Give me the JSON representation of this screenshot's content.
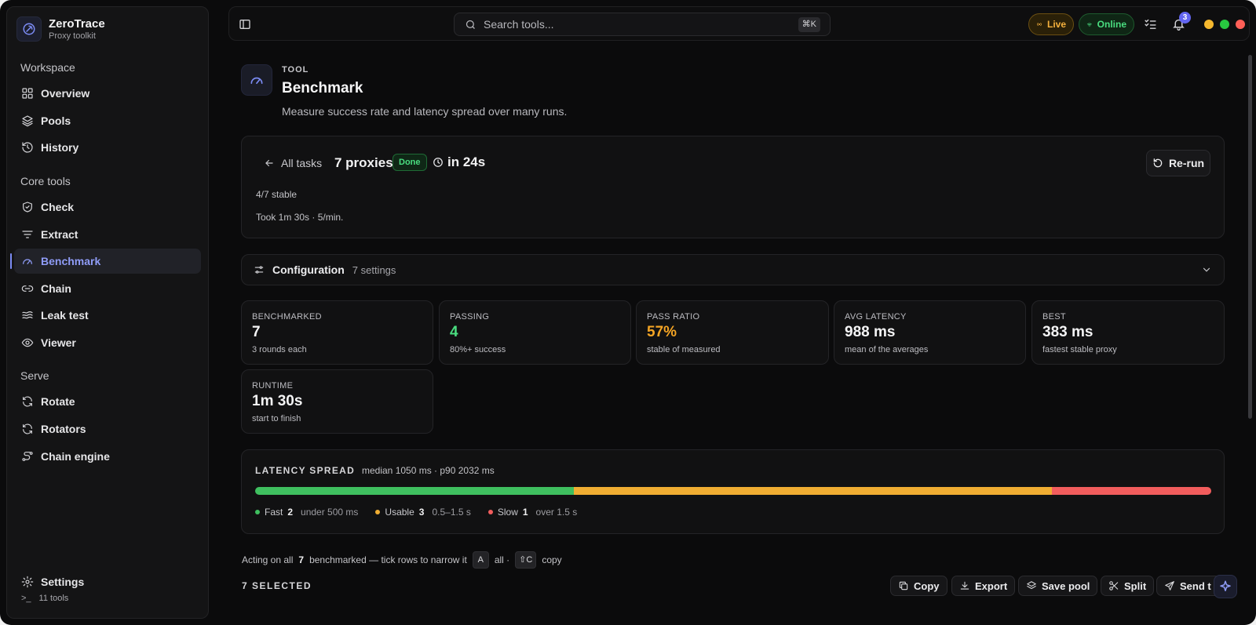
{
  "brand": {
    "name": "ZeroTrace",
    "subtitle": "Proxy toolkit"
  },
  "sidebar": {
    "sections": [
      {
        "title": "Workspace",
        "items": [
          {
            "label": "Overview",
            "icon": "grid-icon"
          },
          {
            "label": "Pools",
            "icon": "layers-icon"
          },
          {
            "label": "History",
            "icon": "history-icon"
          }
        ]
      },
      {
        "title": "Core tools",
        "items": [
          {
            "label": "Check",
            "icon": "shield-check-icon"
          },
          {
            "label": "Extract",
            "icon": "filter-icon"
          },
          {
            "label": "Benchmark",
            "icon": "gauge-icon",
            "active": true
          },
          {
            "label": "Chain",
            "icon": "link-icon"
          },
          {
            "label": "Leak test",
            "icon": "waves-icon"
          },
          {
            "label": "Viewer",
            "icon": "eye-icon"
          }
        ]
      },
      {
        "title": "Serve",
        "items": [
          {
            "label": "Rotate",
            "icon": "refresh-icon"
          },
          {
            "label": "Rotators",
            "icon": "refresh-icon"
          },
          {
            "label": "Chain engine",
            "icon": "route-icon"
          }
        ]
      }
    ],
    "settings_label": "Settings",
    "tools_prompt": ">_",
    "tools_count": "11 tools"
  },
  "topbar": {
    "search_placeholder": "Search tools...",
    "search_shortcut": "⌘K",
    "live_label": "Live",
    "online_label": "Online",
    "notification_count": "3"
  },
  "colors": {
    "accent": "#7c8cf5",
    "fast": "#3fbf5f",
    "usable": "#f0ad32",
    "slow": "#f25d5d",
    "live": "#f5b13d",
    "online": "#4ade80"
  },
  "page": {
    "eyebrow": "TOOL",
    "title": "Benchmark",
    "description": "Measure success rate and latency spread over many runs."
  },
  "task": {
    "back_label": "All tasks",
    "proxies": "7 proxies",
    "status": "Done",
    "duration": "in 24s",
    "rerun_label": "Re-run",
    "stable": "4/7 stable",
    "took": "Took 1m 30s · 5/min."
  },
  "config": {
    "label": "Configuration",
    "count": "7 settings"
  },
  "stats": [
    {
      "label": "BENCHMARKED",
      "value": "7",
      "sub": "3 rounds each",
      "color": "#f4f4f5"
    },
    {
      "label": "PASSING",
      "value": "4",
      "sub": "80%+ success",
      "color": "#4ade80"
    },
    {
      "label": "PASS RATIO",
      "value": "57%",
      "sub": "stable of measured",
      "color": "#f5a524"
    },
    {
      "label": "AVG LATENCY",
      "value": "988 ms",
      "sub": "mean of the averages",
      "color": "#f4f4f5"
    },
    {
      "label": "BEST",
      "value": "383 ms",
      "sub": "fastest stable proxy",
      "color": "#f4f4f5"
    },
    {
      "label": "RUNTIME",
      "value": "1m 30s",
      "sub": "start to finish",
      "color": "#f4f4f5"
    }
  ],
  "spread": {
    "title": "LATENCY SPREAD",
    "meta": "median 1050 ms · p90 2032 ms",
    "segments": [
      {
        "name": "Fast",
        "count": 2,
        "note": "under 500 ms"
      },
      {
        "name": "Usable",
        "count": 3,
        "note": "0.5–1.5 s"
      },
      {
        "name": "Slow",
        "count": 1,
        "note": "over 1.5 s"
      }
    ]
  },
  "selection": {
    "acting_prefix": "Acting on all",
    "acting_count": "7",
    "acting_suffix": "benchmarked — tick rows to narrow it",
    "key_all": "A",
    "key_all_label": "all ·",
    "key_copy": "⇧C",
    "key_copy_label": "copy",
    "selected_label": "7 SELECTED"
  },
  "actions": [
    {
      "label": "Copy",
      "icon": "copy-icon"
    },
    {
      "label": "Export",
      "icon": "download-icon"
    },
    {
      "label": "Save pool",
      "icon": "layers-icon"
    },
    {
      "label": "Split",
      "icon": "scissors-icon"
    },
    {
      "label": "Send t",
      "icon": "send-icon"
    }
  ]
}
